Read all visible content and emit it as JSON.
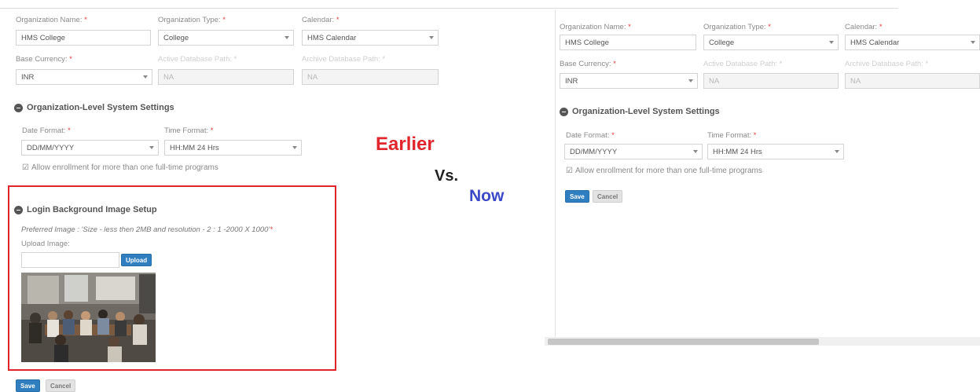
{
  "comparison": {
    "earlier": "Earlier",
    "vs": "Vs.",
    "now": "Now"
  },
  "earlier_panel": {
    "org_name_label": "Organization Name:",
    "org_name_value": "HMS College",
    "org_type_label": "Organization Type:",
    "org_type_value": "College",
    "calendar_label": "Calendar:",
    "calendar_value": "HMS Calendar",
    "base_currency_label": "Base Currency:",
    "base_currency_value": "INR",
    "active_db_label": "Active Database Path:",
    "active_db_value": "NA",
    "archive_db_label": "Archive Database Path:",
    "archive_db_value": "NA",
    "system_settings_title": "Organization-Level System Settings",
    "date_format_label": "Date Format:",
    "date_format_value": "DD/MM/YYYY",
    "time_format_label": "Time Format:",
    "time_format_value": "HH:MM 24 Hrs",
    "allow_enrollment_label": "Allow enrollment for more than one full-time programs",
    "login_bg_title": "Login Background Image Setup",
    "preferred_image_note": "Preferred Image : 'Size - less then 2MB and resolution - 2 : 1 -2000 X 1000'",
    "upload_image_label": "Upload Image:",
    "upload_button": "Upload",
    "save_button": "Save",
    "cancel_button": "Cancel"
  },
  "now_panel": {
    "org_name_label": "Organization Name:",
    "org_name_value": "HMS College",
    "org_type_label": "Organization Type:",
    "org_type_value": "College",
    "calendar_label": "Calendar:",
    "calendar_value": "HMS Calendar",
    "base_currency_label": "Base Currency:",
    "base_currency_value": "INR",
    "active_db_label": "Active Database Path:",
    "active_db_value": "NA",
    "archive_db_label": "Archive Database Path:",
    "archive_db_value": "NA",
    "system_settings_title": "Organization-Level System Settings",
    "date_format_label": "Date Format:",
    "date_format_value": "DD/MM/YYYY",
    "time_format_label": "Time Format:",
    "time_format_value": "HH:MM 24 Hrs",
    "allow_enrollment_label": "Allow enrollment for more than one full-time programs",
    "save_button": "Save",
    "cancel_button": "Cancel"
  },
  "required_marker": "*",
  "icons": {
    "collapse": "minus-circle-icon",
    "checkbox": "checkbox-checked-icon",
    "dropdown": "chevron-down-icon"
  },
  "colors": {
    "highlight_border": "#e1252b",
    "earlier_text": "#e0262c",
    "now_text": "#3b49c7",
    "primary_button": "#2f7ec0"
  }
}
